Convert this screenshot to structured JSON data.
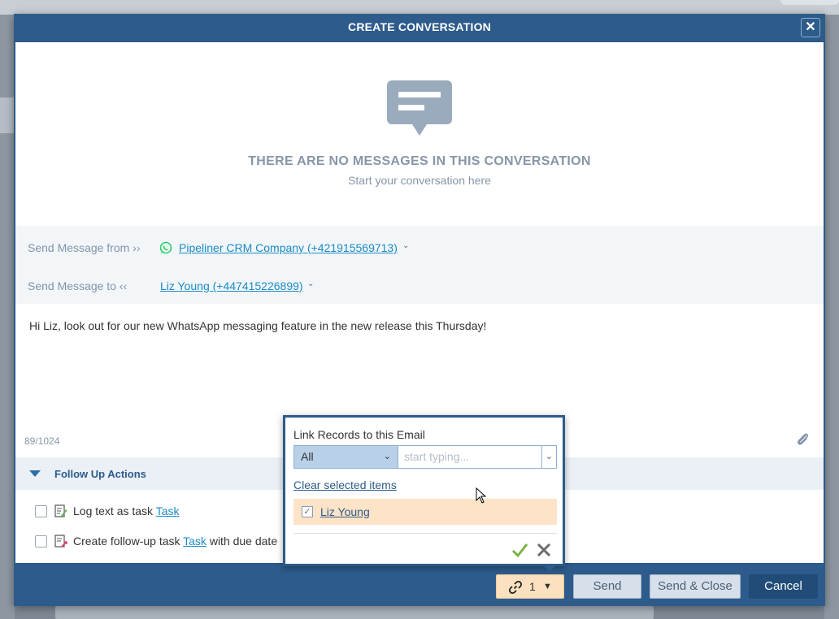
{
  "dialog": {
    "title": "CREATE CONVERSATION",
    "close_label": "✕"
  },
  "empty_state": {
    "icon": "chat-bubble-icon",
    "title": "THERE ARE NO MESSAGES IN THIS CONVERSATION",
    "subtitle": "Start your conversation here"
  },
  "send_from": {
    "label": "Send Message from ››",
    "value": "Pipeliner CRM Company (+421915569713)",
    "icon": "whatsapp-icon"
  },
  "send_to": {
    "label": "Send Message to ‹‹",
    "value": "Liz Young (+447415226899)"
  },
  "message": {
    "text": "Hi Liz, look out for our new WhatsApp messaging feature in the new release this Thursday!",
    "char_count": "89/1024"
  },
  "follow_up": {
    "title": "Follow Up Actions",
    "items": [
      {
        "prefix": "Log text as task ",
        "link": "Task",
        "suffix": ""
      },
      {
        "prefix": "Create follow-up task ",
        "link": "Task",
        "suffix": " with due date"
      }
    ]
  },
  "footer": {
    "link_count": "1",
    "send_label": "Send",
    "send_close_label": "Send & Close",
    "cancel_label": "Cancel"
  },
  "link_popup": {
    "title": "Link Records to this Email",
    "filter_value": "All",
    "search_placeholder": "start typing...",
    "clear_label": "Clear selected items",
    "selected_items": [
      {
        "label": "Liz Young",
        "checked": true
      }
    ]
  },
  "colors": {
    "header": "#2d5b8b",
    "link": "#1a8ac6",
    "selected_row": "#fde3c7",
    "whatsapp": "#25d366"
  }
}
